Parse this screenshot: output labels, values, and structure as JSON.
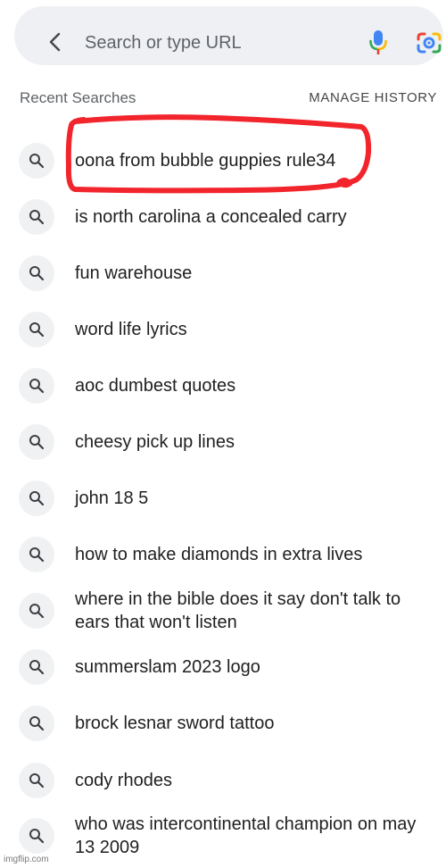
{
  "toolbar": {
    "back_icon": "chevron-left-icon",
    "search_placeholder": "Search or type URL",
    "mic_icon": "google-mic-icon",
    "lens_icon": "google-lens-camera-icon"
  },
  "recent_searches": {
    "heading": "Recent Searches",
    "manage_history_label": "MANAGE HISTORY",
    "item_icon": "search-icon",
    "items": [
      "oona from bubble guppies rule34",
      "is north carolina a concealed carry",
      "fun warehouse",
      "word life lyrics",
      "aoc dumbest quotes",
      "cheesy pick up lines",
      "john 18 5",
      "how to make diamonds in extra lives",
      "where in the bible does it say don't talk to ears that won't listen",
      "summerslam 2023 logo",
      "brock lesnar sword tattoo",
      "cody rhodes",
      "who was intercontinental champion on may 13 2009"
    ]
  },
  "annotation": {
    "color": "#f2242c"
  },
  "colors": {
    "search_bar_bg": "#eef0f3",
    "icon_circle_bg": "#f0f1f3",
    "secondary_text": "#5f6368"
  },
  "watermark": {
    "text": "imgflip.com"
  }
}
